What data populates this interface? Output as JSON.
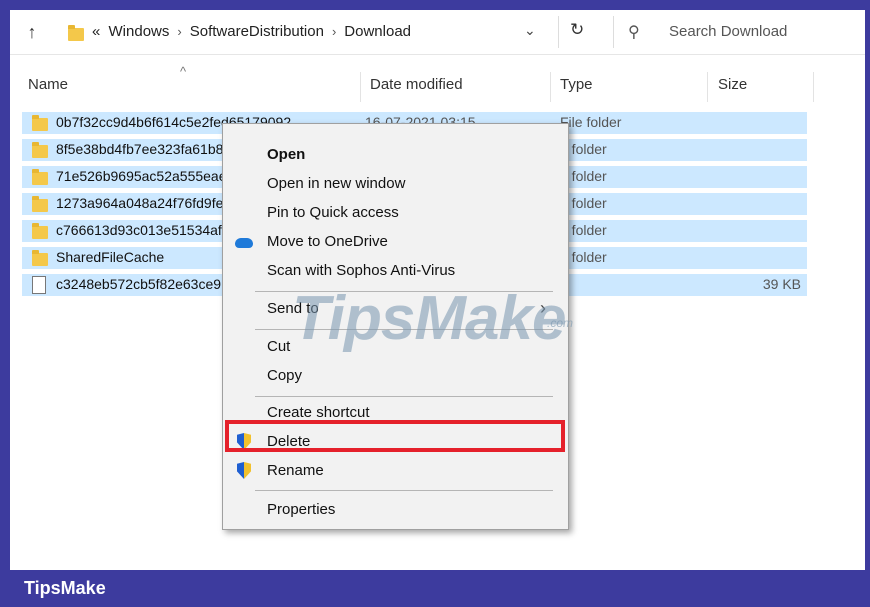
{
  "address_bar": {
    "breadcrumbs": [
      "Windows",
      "SoftwareDistribution",
      "Download"
    ],
    "overflow": "«",
    "separator": "›",
    "search_placeholder": "Search Download"
  },
  "columns": {
    "name": "Name",
    "date": "Date modified",
    "type": "Type",
    "size": "Size"
  },
  "rows": [
    {
      "name": "0b7f32cc9d4b6f614c5e2fed65179092",
      "date": "16-07-2021 03:15",
      "type": "File folder",
      "size": "",
      "icon": "folder-icon"
    },
    {
      "name": "8f5e38bd4fb7ee323fa61b8",
      "date": "",
      "type": "e folder",
      "size": "",
      "icon": "folder-icon"
    },
    {
      "name": "71e526b9695ac52a555eae",
      "date": "",
      "type": "e folder",
      "size": "",
      "icon": "folder-icon"
    },
    {
      "name": "1273a964a048a24f76fd9fe",
      "date": "",
      "type": "e folder",
      "size": "",
      "icon": "folder-icon"
    },
    {
      "name": "c766613d93c013e51534aff",
      "date": "",
      "type": "e folder",
      "size": "",
      "icon": "folder-icon"
    },
    {
      "name": "SharedFileCache",
      "date": "",
      "type": "e folder",
      "size": "",
      "icon": "folder-icon"
    },
    {
      "name": "c3248eb572cb5f82e63ce9",
      "date": "",
      "type": "e",
      "size": "39 KB",
      "icon": "file-icon"
    }
  ],
  "context_menu": {
    "open": "Open",
    "open_new_window": "Open in new window",
    "pin_quick_access": "Pin to Quick access",
    "move_onedrive": "Move to OneDrive",
    "scan_sophos": "Scan with Sophos Anti-Virus",
    "send_to": "Send to",
    "cut": "Cut",
    "copy": "Copy",
    "create_shortcut": "Create shortcut",
    "delete": "Delete",
    "rename": "Rename",
    "properties": "Properties"
  },
  "watermark": {
    "text": "TipsMake",
    "suffix": ".com"
  },
  "footer": {
    "brand": "TipsMake"
  },
  "colors": {
    "selection": "#cce8ff",
    "highlight_box": "#e5212b",
    "background": "#3d3b9e"
  }
}
